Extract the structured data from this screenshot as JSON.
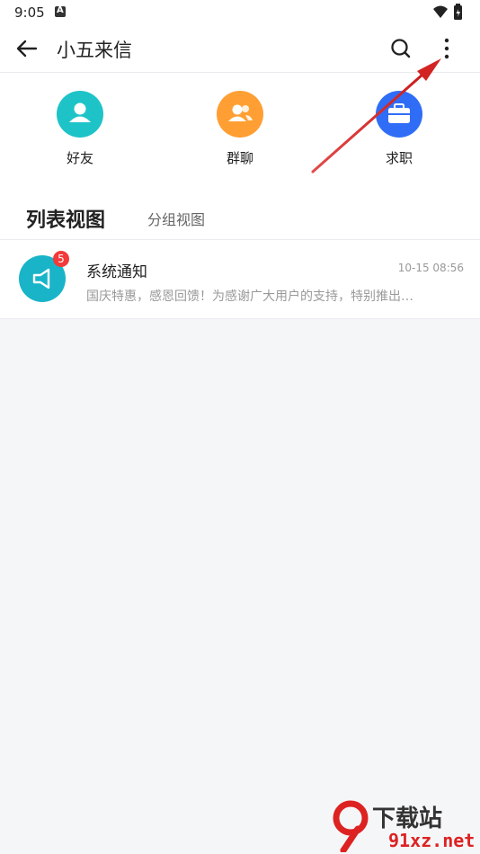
{
  "status_bar": {
    "time": "9:05"
  },
  "app_bar": {
    "title": "小五来信"
  },
  "quick_actions": [
    {
      "label": "好友",
      "color": "#1ec3c8",
      "icon": "user-icon"
    },
    {
      "label": "群聊",
      "color": "#ff9f33",
      "icon": "group-icon"
    },
    {
      "label": "求职",
      "color": "#2f6df6",
      "icon": "briefcase-icon"
    }
  ],
  "tabs": {
    "active": "列表视图",
    "other": "分组视图"
  },
  "conversations": [
    {
      "title": "系统通知",
      "time": "10-15 08:56",
      "preview": "国庆特惠，感恩回馈！为感谢广大用户的支持，特别推出…",
      "badge": "5",
      "avatar_color": "#19b4c8",
      "icon": "speaker-icon"
    }
  ],
  "watermark": {
    "top": "下载站",
    "bottom": "91xz.net"
  },
  "colors": {
    "annotation_arrow": "#d32424",
    "badge": "#f23a3a"
  }
}
